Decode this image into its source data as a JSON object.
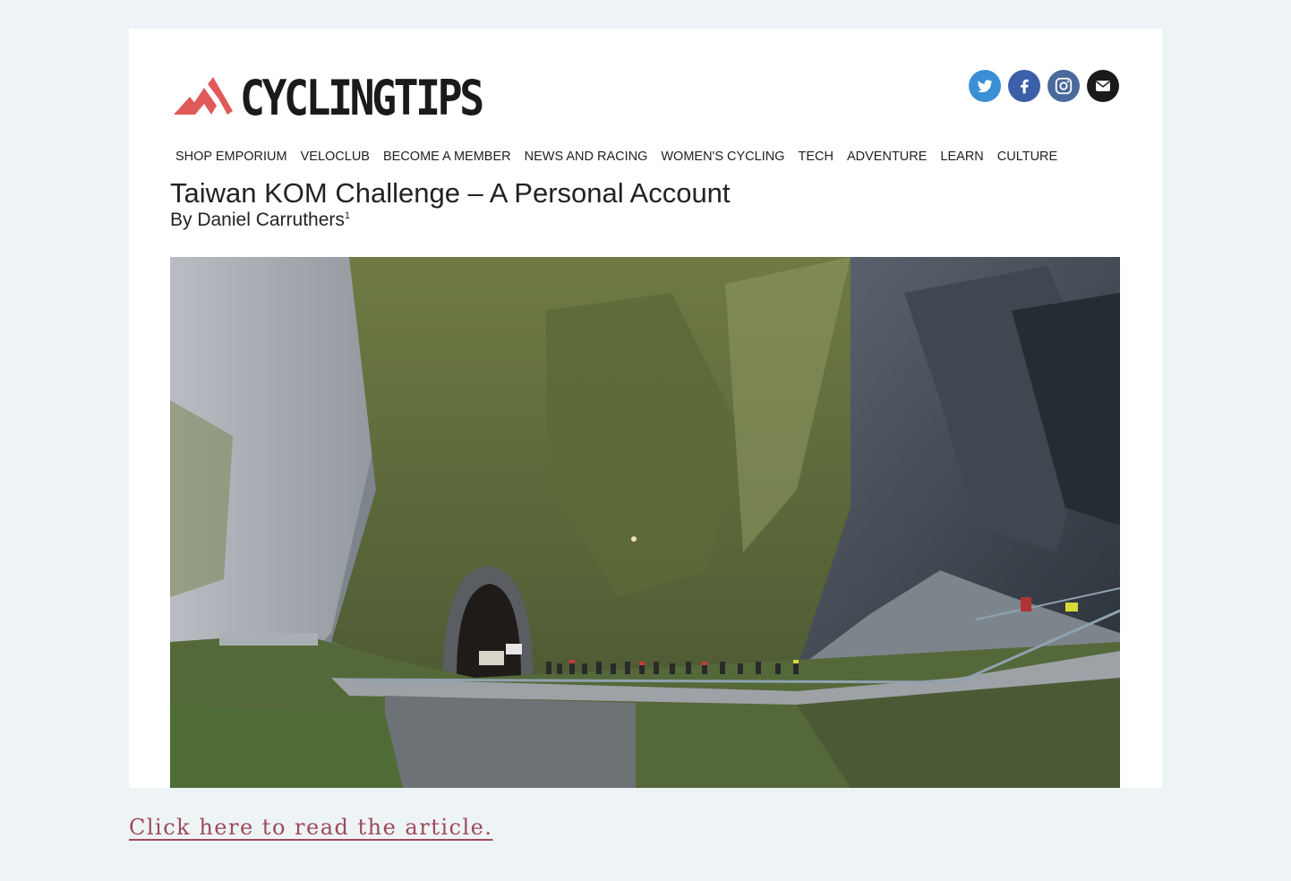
{
  "brand": {
    "name": "CYCLINGTIPS",
    "accent": "#e05a5a"
  },
  "social": [
    {
      "icon": "twitter-icon",
      "color": "#3a8fd6"
    },
    {
      "icon": "facebook-icon",
      "color": "#3b5fa8"
    },
    {
      "icon": "instagram-icon",
      "color": "#4a6a9c"
    },
    {
      "icon": "email-icon",
      "color": "#1a1a1a"
    }
  ],
  "nav": {
    "items": [
      "SHOP EMPORIUM",
      "VELOCLUB",
      "BECOME A MEMBER",
      "NEWS AND RACING",
      "WOMEN'S CYCLING",
      "TECH",
      "ADVENTURE",
      "LEARN",
      "CULTURE"
    ]
  },
  "article": {
    "title": "Taiwan KOM Challenge – A Personal Account",
    "byline": "By Daniel Carruthers",
    "footnote": "1"
  },
  "link": {
    "text": "Click here to read the article.",
    "color": "#9c4a5a"
  }
}
